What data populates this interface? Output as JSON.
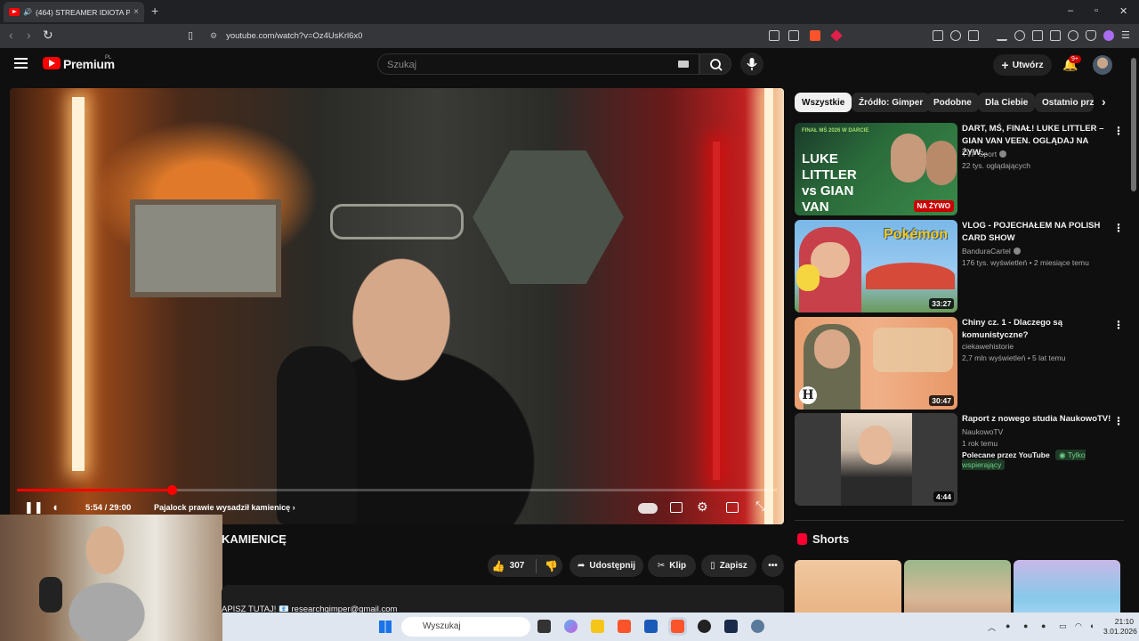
{
  "browser": {
    "tab_title": "(464) STREAMER IDIOTA PRA",
    "tab_close": "×",
    "new_tab": "+",
    "url": "youtube.com/watch?v=Oz4UsKrl6x0",
    "window_controls": [
      "–",
      "▫",
      "✕"
    ]
  },
  "youtube": {
    "brand": "Premium",
    "region": "PL",
    "search_placeholder": "Szukaj",
    "create_label": "Utwórz",
    "notification_count": "9+"
  },
  "player": {
    "current_time": "5:54",
    "duration": "29:00",
    "time_display": "5:54 / 29:00",
    "chapter": "Pajalock prawie wysadził kamienicę",
    "progress_fraction": 0.204
  },
  "video": {
    "title": "KAMIENICĘ",
    "likes": "307",
    "share_label": "Udostępnij",
    "clip_label": "Klip",
    "save_label": "Zapisz",
    "description": "APISZ TUTAJ! 📧 researchgimper@gmail.com"
  },
  "sidebar": {
    "chips": [
      "Wszystkie",
      "Źródło: Gimper",
      "Podobne",
      "Dla Ciebie",
      "Ostatnio prze"
    ],
    "recommendations": [
      {
        "title": "DART, MŚ, FINAŁ! LUKE LITTLER – GIAN VAN VEEN. OGLĄDAJ NA ŻYW...",
        "channel": "TVP Sport",
        "meta": "22 tys. oglądających",
        "badge": "NA ŻYWO",
        "thumb_text": "LUKE LITTLER vs GIAN VAN VEEN",
        "thumb_top": "FINAŁ MŚ 2026 W DARCIE"
      },
      {
        "title": "VLOG - POJECHAŁEM NA POLISH CARD SHOW",
        "channel": "BanduraCartel",
        "meta": "176 tys. wyświetleń • 2 miesiące temu",
        "duration": "33:27",
        "thumb_text": "Pokémon"
      },
      {
        "title": "Chiny cz. 1 - Dlaczego są komunistyczne?",
        "channel": "ciekawehistorie",
        "meta": "2,7 mln wyświetleń • 5 lat temu",
        "duration": "30:47",
        "thumb_text": "H"
      },
      {
        "title": "Raport z nowego studia NaukowoTV!",
        "channel": "NaukowoTV",
        "meta": "1 rok temu",
        "extra": "Polecane przez YouTube",
        "members": "Tylko wspierający",
        "duration": "4:44"
      }
    ],
    "shorts_label": "Shorts"
  },
  "taskbar": {
    "search_placeholder": "Wyszukaj",
    "time": "21:10",
    "date": "3.01.2026"
  }
}
